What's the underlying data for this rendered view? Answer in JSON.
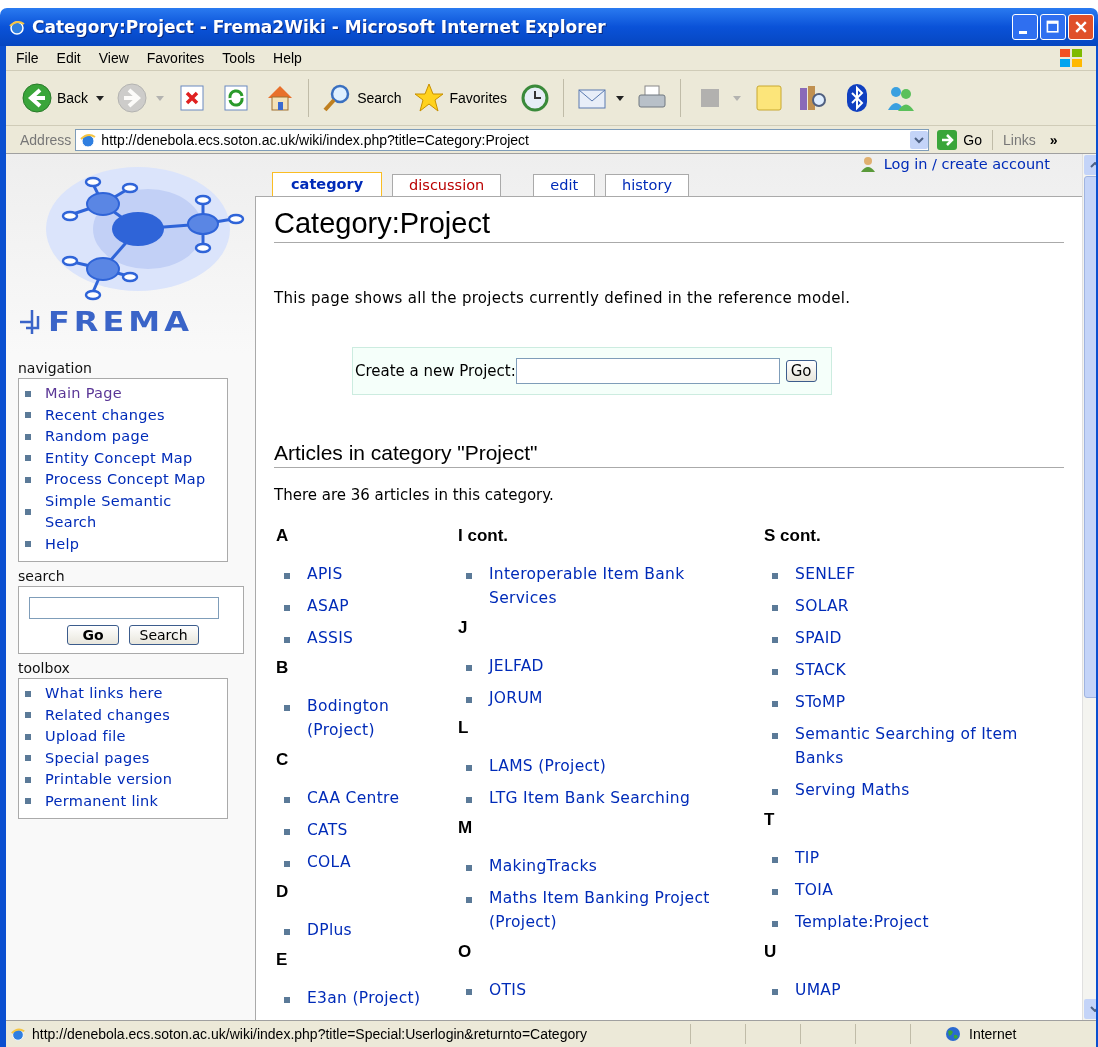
{
  "window": {
    "title": "Category:Project - Frema2Wiki - Microsoft Internet Explorer"
  },
  "menu_bar": [
    "File",
    "Edit",
    "View",
    "Favorites",
    "Tools",
    "Help"
  ],
  "toolbar": [
    {
      "kind": "back",
      "label": "Back",
      "dropdown": true,
      "disabled": false
    },
    {
      "kind": "forward",
      "dropdown": true,
      "disabled": true
    },
    {
      "kind": "stop",
      "dropdown": false,
      "disabled": false
    },
    {
      "kind": "refresh",
      "dropdown": false,
      "disabled": false
    },
    {
      "kind": "home",
      "dropdown": false,
      "disabled": false
    },
    {
      "kind": "search",
      "label": "Search",
      "dropdown": false,
      "disabled": false
    },
    {
      "kind": "favorites",
      "label": "Favorites",
      "dropdown": false,
      "disabled": false
    },
    {
      "kind": "history",
      "dropdown": false,
      "disabled": false
    },
    {
      "kind": "mail",
      "dropdown": true,
      "disabled": false
    },
    {
      "kind": "print",
      "dropdown": false,
      "disabled": false
    },
    {
      "kind": "edit",
      "dropdown": true,
      "disabled": true
    },
    {
      "kind": "note",
      "dropdown": false,
      "disabled": false
    },
    {
      "kind": "research",
      "dropdown": false,
      "disabled": false
    },
    {
      "kind": "bluetooth",
      "dropdown": false,
      "disabled": false
    },
    {
      "kind": "messenger",
      "dropdown": false,
      "disabled": false
    }
  ],
  "address_bar": {
    "label": "Address",
    "url": "http://denebola.ecs.soton.ac.uk/wiki/index.php?title=Category:Project",
    "go": "Go",
    "links": "Links",
    "more": "»"
  },
  "user_links": {
    "login": "Log in / create account"
  },
  "logo": {
    "text": "FREMA"
  },
  "sidebar": [
    {
      "kind": "links",
      "title": "navigation",
      "items": [
        {
          "label": "Main Page",
          "visited": true
        },
        {
          "label": "Recent changes",
          "visited": false
        },
        {
          "label": "Random page",
          "visited": false
        },
        {
          "label": "Entity Concept Map",
          "visited": false
        },
        {
          "label": "Process Concept Map",
          "visited": false
        },
        {
          "label": "Simple Semantic Search",
          "visited": false
        },
        {
          "label": "Help",
          "visited": false
        }
      ]
    },
    {
      "kind": "search",
      "title": "search",
      "buttons": [
        "Go",
        "Search"
      ]
    },
    {
      "kind": "links",
      "title": "toolbox",
      "items": [
        {
          "label": "What links here",
          "visited": false
        },
        {
          "label": "Related changes",
          "visited": false
        },
        {
          "label": "Upload file",
          "visited": false
        },
        {
          "label": "Special pages",
          "visited": false
        },
        {
          "label": "Printable version",
          "visited": false
        },
        {
          "label": "Permanent link",
          "visited": false
        }
      ]
    }
  ],
  "tabs": [
    {
      "label": "category",
      "selected": true,
      "missing": false
    },
    {
      "label": "discussion",
      "selected": false,
      "missing": true
    },
    {
      "label": "edit",
      "selected": false,
      "missing": false
    },
    {
      "label": "history",
      "selected": false,
      "missing": false
    }
  ],
  "page": {
    "title": "Category:Project",
    "intro": "This page shows all the projects currently defined in the reference model.",
    "create_form": {
      "label": "Create a new Project:",
      "button": "Go"
    },
    "articles_heading": "Articles in category \"Project\"",
    "count_text": "There are 36 articles in this category.",
    "columns": [
      [
        {
          "heading": "A",
          "items": [
            "APIS",
            "ASAP",
            "ASSIS"
          ]
        },
        {
          "heading": "B",
          "items": [
            "Bodington (Project)"
          ]
        },
        {
          "heading": "C",
          "items": [
            "CAA Centre",
            "CATS",
            "COLA"
          ]
        },
        {
          "heading": "D",
          "items": [
            "DPlus"
          ]
        },
        {
          "heading": "E",
          "items": [
            "E3an (Project)"
          ]
        }
      ],
      [
        {
          "heading": "I cont.",
          "items": [
            "Interoperable Item Bank Services"
          ]
        },
        {
          "heading": "J",
          "items": [
            "JELFAD",
            "JORUM"
          ]
        },
        {
          "heading": "L",
          "items": [
            "LAMS (Project)",
            "LTG Item Bank Searching"
          ]
        },
        {
          "heading": "M",
          "items": [
            "MakingTracks",
            "Maths Item Banking Project (Project)"
          ]
        },
        {
          "heading": "O",
          "items": [
            "OTIS"
          ]
        }
      ],
      [
        {
          "heading": "S cont.",
          "items": [
            "SENLEF",
            "SOLAR",
            "SPAID",
            "STACK",
            "SToMP",
            "Semantic Searching of Item Banks",
            "Serving Maths"
          ]
        },
        {
          "heading": "T",
          "items": [
            "TIP",
            "TOIA",
            "Template:Project"
          ]
        },
        {
          "heading": "U",
          "items": [
            "UMAP"
          ]
        }
      ]
    ]
  },
  "status_bar": {
    "url": "http://denebola.ecs.soton.ac.uk/wiki/index.php?title=Special:Userlogin&returnto=Category",
    "zone": "Internet"
  }
}
